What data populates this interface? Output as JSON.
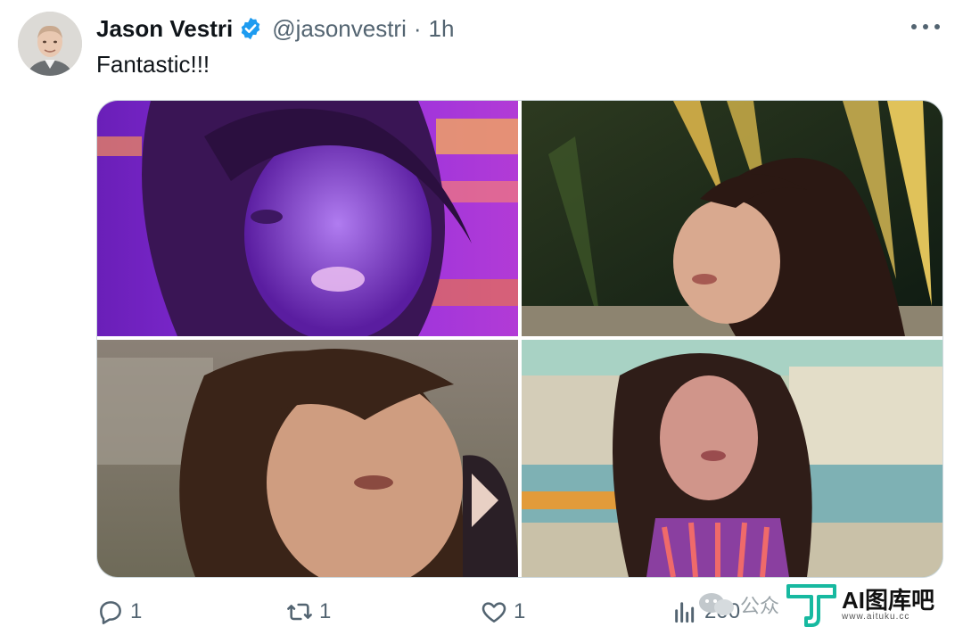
{
  "tweet": {
    "author_name": "Jason Vestri",
    "handle": "@jasonvestri",
    "separator": "·",
    "time": "1h",
    "text": "Fantastic!!!"
  },
  "media": {
    "count": 4
  },
  "actions": {
    "reply_count": "1",
    "retweet_count": "1",
    "like_count": "1",
    "views_count": "200"
  },
  "watermark": {
    "chat_label": "公众",
    "brand": "AI图库吧",
    "url": "www.aituku.cc"
  },
  "colors": {
    "verified": "#1d9bf0",
    "muted": "#536471",
    "border": "#cfd9de",
    "accent_green": "#17b9a0"
  },
  "icons": [
    "verified-badge-icon",
    "more-icon",
    "reply-icon",
    "retweet-icon",
    "like-icon",
    "views-icon"
  ]
}
